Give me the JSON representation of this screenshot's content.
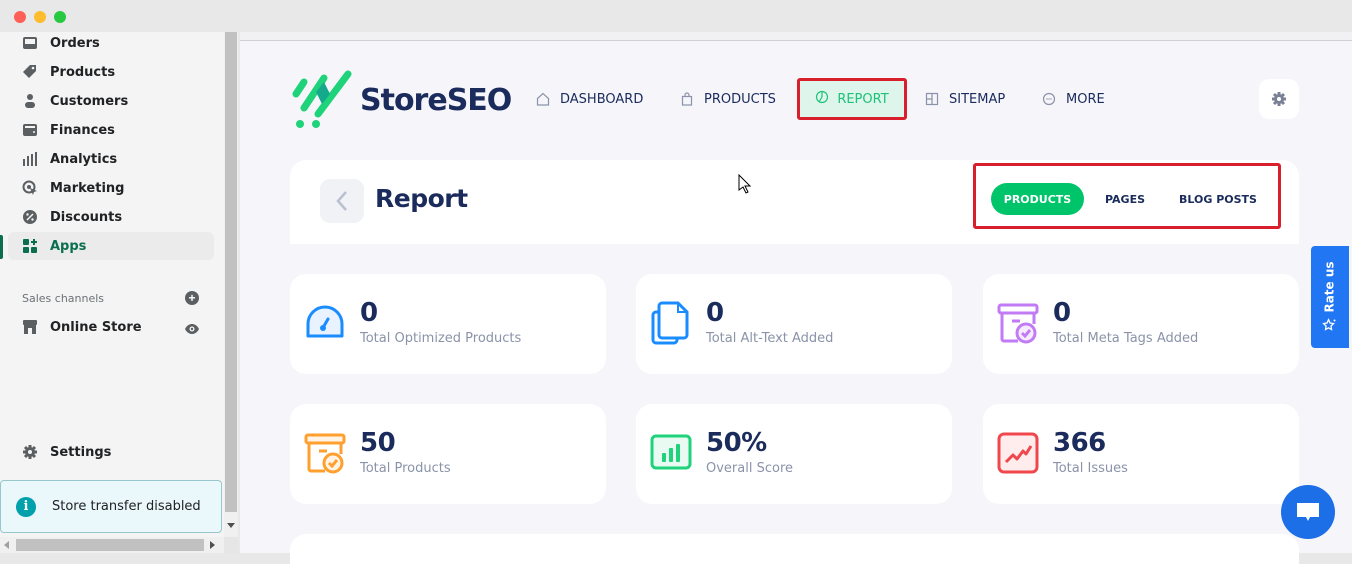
{
  "window": {
    "controls": [
      "close",
      "minimize",
      "maximize"
    ]
  },
  "sidebar": {
    "items": [
      {
        "label": "Orders",
        "icon": "inbox-icon"
      },
      {
        "label": "Products",
        "icon": "tag-icon"
      },
      {
        "label": "Customers",
        "icon": "person-icon"
      },
      {
        "label": "Finances",
        "icon": "wallet-icon"
      },
      {
        "label": "Analytics",
        "icon": "bar-chart-icon"
      },
      {
        "label": "Marketing",
        "icon": "target-icon"
      },
      {
        "label": "Discounts",
        "icon": "discount-icon"
      },
      {
        "label": "Apps",
        "icon": "apps-icon",
        "active": true
      }
    ],
    "sales_channels_label": "Sales channels",
    "online_store_label": "Online Store",
    "settings_label": "Settings",
    "transfer_notice": "Store transfer disabled",
    "active_color": "#0b6e4f"
  },
  "app": {
    "brand": "StoreSEO",
    "brand_color": "#1a2b5c",
    "accent_color": "#00c46a",
    "nav": [
      {
        "label": "DASHBOARD",
        "icon": "home-icon"
      },
      {
        "label": "PRODUCTS",
        "icon": "shopping-bag-icon"
      },
      {
        "label": "REPORT",
        "icon": "pie-chart-icon",
        "active": true
      },
      {
        "label": "SITEMAP",
        "icon": "sitemap-icon"
      },
      {
        "label": "MORE",
        "icon": "more-icon"
      }
    ],
    "settings_icon": "gear-icon"
  },
  "report": {
    "title": "Report",
    "tabs": [
      {
        "label": "PRODUCTS",
        "active": true
      },
      {
        "label": "PAGES",
        "active": false
      },
      {
        "label": "BLOG POSTS",
        "active": false
      }
    ],
    "stats": [
      {
        "value": "0",
        "caption": "Total Optimized Products",
        "icon": "speedometer-icon",
        "color": "#1a8cff"
      },
      {
        "value": "0",
        "caption": "Total Alt-Text Added",
        "icon": "documents-icon",
        "color": "#1a8cff"
      },
      {
        "value": "0",
        "caption": "Total Meta Tags Added",
        "icon": "archive-check-icon",
        "color": "#c07bf5"
      },
      {
        "value": "50",
        "caption": "Total Products",
        "icon": "box-check-icon",
        "color": "#ff9f2e"
      },
      {
        "value": "50%",
        "caption": "Overall Score",
        "icon": "score-chart-icon",
        "color": "#1ed37a"
      },
      {
        "value": "366",
        "caption": "Total Issues",
        "icon": "trend-icon",
        "color": "#f0474c"
      }
    ]
  },
  "widgets": {
    "rate_us": "Rate us",
    "chat": "chat-icon"
  }
}
